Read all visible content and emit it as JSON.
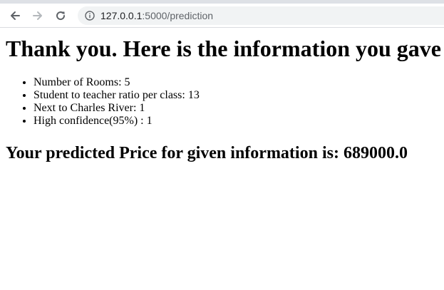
{
  "browser": {
    "url_host": "127.0.0.1",
    "url_path": ":5000/prediction",
    "icons": {
      "back": "arrow-left-icon",
      "forward": "arrow-right-icon",
      "reload": "reload-icon",
      "site_info": "info-icon"
    }
  },
  "page": {
    "heading": "Thank you. Here is the information you gave",
    "info_items": [
      {
        "label": "Number of Rooms: 5"
      },
      {
        "label": "Student to teacher ratio per class: 13"
      },
      {
        "label": "Next to Charles River: 1"
      },
      {
        "label": "High confidence(95%) : 1"
      }
    ],
    "result": "Your predicted Price for given information is: 689000.0"
  }
}
